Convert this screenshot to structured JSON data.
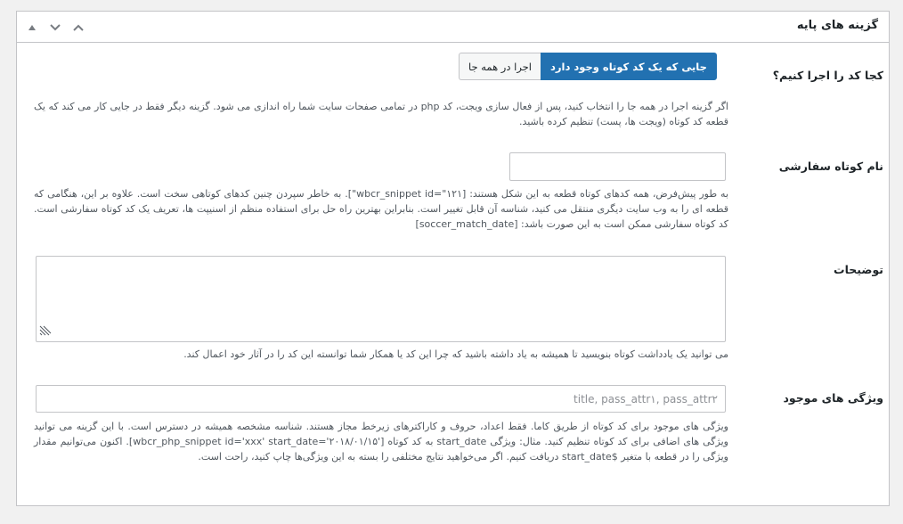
{
  "panel": {
    "title": "گزینه های پایه"
  },
  "header_controls": [
    {
      "icon": "triangle-up-icon"
    },
    {
      "icon": "chevron-down-icon"
    },
    {
      "icon": "chevron-up-icon"
    }
  ],
  "run_location": {
    "label": "کجا کد را اجرا کنیم؟",
    "options": [
      "جایی که یک کد کوتاه وجود دارد",
      "اجرا در همه جا"
    ],
    "selected": "جایی که یک کد کوتاه وجود دارد",
    "description": "اگر گزینه اجرا در همه جا را انتخاب کنید، پس از فعال سازی ویجت، کد php در تمامی صفحات سایت شما راه اندازی می شود. گزینه دیگر فقط در جایی کار می کند که یک قطعه کد کوتاه (ویجت ها، پست) تنظیم کرده باشید."
  },
  "custom_shortcode": {
    "label": "نام کوتاه سفارشی",
    "value": "",
    "description": "به طور پیش‌فرض، همه کدهای کوتاه قطعه به این شکل هستند: [wbcr_snippet id=\"۱۲۱\"]. به خاطر سپردن چنین کدهای کوتاهی سخت است. علاوه بر این، هنگامی که قطعه ای را به وب سایت دیگری منتقل می کنید، شناسه آن قابل تغییر است. بنابراین بهترین راه حل برای استفاده منظم از اسنیپت ها، تعریف یک کد کوتاه سفارشی است. کد کوتاه سفارشی ممکن است به این صورت باشد: [soccer_match_date]"
  },
  "notes": {
    "label": "توضیحات",
    "value": "",
    "description": "می توانید یک یادداشت کوتاه بنویسید تا همیشه به یاد داشته باشید که چرا این کد یا همکار شما توانسته این کد را در آثار خود اعمال کند."
  },
  "attributes": {
    "label": "ویژگی های موجود",
    "placeholder": "title, pass_attr۱, pass_attr۲",
    "description": "ویژگی های موجود برای کد کوتاه از طریق کاما. فقط اعداد، حروف و کاراکترهای زیرخط مجاز هستند. شناسه مشخصه همیشه در دسترس است. با این گزینه می توانید ویژگی های اضافی برای کد کوتاه تنظیم کنید. مثال: ویژگی start_date به کد کوتاه ['wbcr_php_snippet id='xxx' start_date='۲۰۱۸/۰۱/۱۵]. اکنون می‌توانیم مقدار ویژگی را در قطعه با متغیر $start_date دریافت کنیم. اگر می‌خواهید نتایج مختلفی را بسته به این ویژگی‌ها چاپ کنید، راحت است."
  },
  "colors": {
    "accent": "#2271b1",
    "border": "#c3c4c7",
    "background": "#f1f1f1"
  }
}
